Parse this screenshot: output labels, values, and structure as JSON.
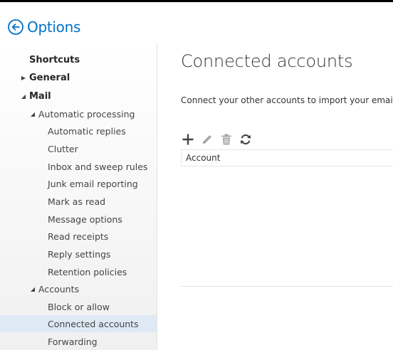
{
  "header": {
    "title": "Options",
    "back_icon": "circle-arrow-left-icon",
    "accent": "#0072c6"
  },
  "nav": {
    "items": [
      {
        "label": "Shortcuts"
      },
      {
        "label": "General"
      },
      {
        "label": "Mail"
      },
      {
        "label": "Automatic processing"
      },
      {
        "label": "Automatic replies"
      },
      {
        "label": "Clutter"
      },
      {
        "label": "Inbox and sweep rules"
      },
      {
        "label": "Junk email reporting"
      },
      {
        "label": "Mark as read"
      },
      {
        "label": "Message options"
      },
      {
        "label": "Read receipts"
      },
      {
        "label": "Reply settings"
      },
      {
        "label": "Retention policies"
      },
      {
        "label": "Accounts"
      },
      {
        "label": "Block or allow"
      },
      {
        "label": "Connected accounts"
      },
      {
        "label": "Forwarding"
      }
    ],
    "selected": "Connected accounts",
    "selected_color": "#dfe9f5"
  },
  "main": {
    "title": "Connected accounts",
    "description": "Connect your other accounts to import your email a",
    "toolbar": {
      "icons": [
        "add-icon",
        "edit-icon",
        "delete-icon",
        "refresh-icon"
      ]
    },
    "table": {
      "columns": [
        "Account"
      ]
    }
  }
}
